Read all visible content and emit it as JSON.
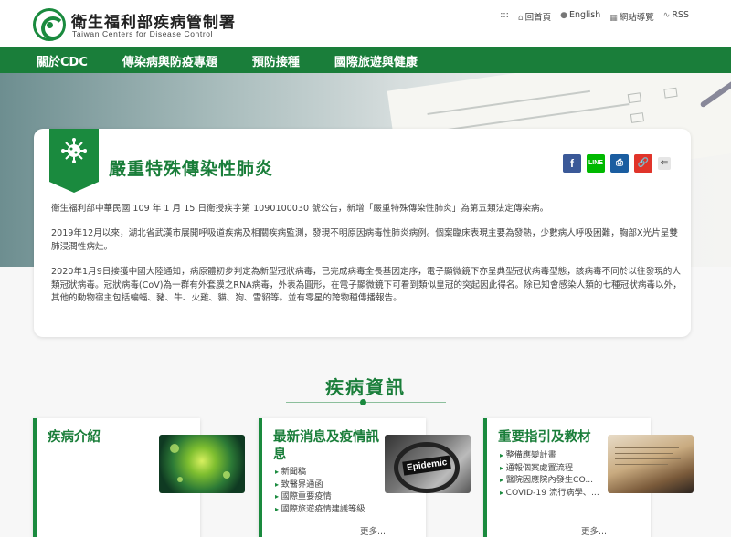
{
  "header": {
    "org_zh": "衛生福利部疾病管制署",
    "org_en": "Taiwan Centers for Disease Control",
    "links": [
      {
        "icon": "grid-icon",
        "label": ":::"
      },
      {
        "icon": "home-icon",
        "label": "回首頁"
      },
      {
        "icon": "globe-icon",
        "label": "English"
      },
      {
        "icon": "sitemap-icon",
        "label": "網站導覽"
      },
      {
        "icon": "rss-icon",
        "label": "RSS"
      }
    ]
  },
  "nav": {
    "items": [
      "關於CDC",
      "傳染病與防疫專題",
      "預防接種",
      "國際旅遊與健康"
    ]
  },
  "article": {
    "title": "嚴重特殊傳染性肺炎",
    "share": {
      "facebook": "f",
      "line": "LINE",
      "print": "⎙",
      "link": "🔗",
      "back": "⇐"
    },
    "paragraphs": [
      "衛生福利部中華民國 109 年 1 月 15 日衛授疾字第 1090100030 號公告，新增「嚴重特殊傳染性肺炎」為第五類法定傳染病。",
      "2019年12月以來，湖北省武漢市展開呼吸道疾病及相關疾病監測，發現不明原因病毒性肺炎病例。個案臨床表現主要為發熱，少數病人呼吸困難，胸部X光片呈雙肺浸潤性病灶。",
      "2020年1月9日接獲中國大陸通知，病原體初步判定為新型冠狀病毒，已完成病毒全長基因定序，電子顯微鏡下亦呈典型冠狀病毒型態，該病毒不同於以往發現的人類冠狀病毒。冠狀病毒(CoV)為一群有外套膜之RNA病毒，外表為圓形，在電子顯微鏡下可看到類似皇冠的突起因此得名。除已知會感染人類的七種冠狀病毒以外，其他的動物宿主包括蝙蝠、豬、牛、火雞、貓、狗、雪貂等。並有零星的跨物種傳播報告。"
    ]
  },
  "section": {
    "title": "疾病資訊",
    "boxes": [
      {
        "title": "疾病介紹",
        "items": [],
        "more": ""
      },
      {
        "title": "最新消息及疫情訊息",
        "image_label": "Epidemic",
        "items": [
          "新聞稿",
          "致醫界通函",
          "國際重要疫情",
          "國際旅遊疫情建議等級"
        ],
        "more": "更多..."
      },
      {
        "title": "重要指引及教材",
        "items": [
          "整備應變計畫",
          "通報個案處置流程",
          "醫院因應院內發生CO...",
          "COVID-19 流行病學、..."
        ],
        "more": "更多..."
      }
    ]
  },
  "colors": {
    "brand_green": "#1a7e3a",
    "accent_green": "#1a8a3e"
  }
}
